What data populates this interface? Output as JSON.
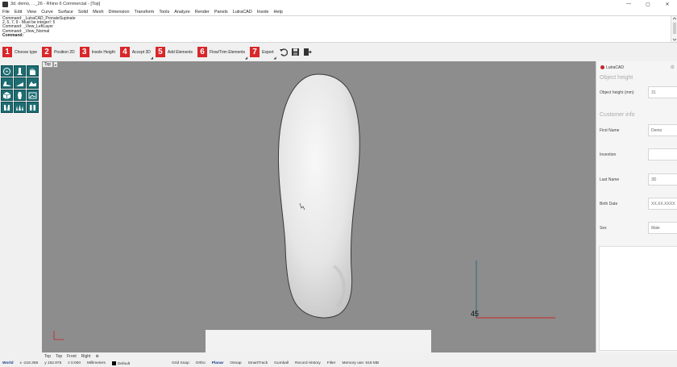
{
  "window": {
    "title": "3d. demo, . ._26 - Rhino 6 Commercial - [Top]",
    "controls": [
      "—",
      "▢",
      "✕"
    ]
  },
  "menu": [
    "File",
    "Edit",
    "View",
    "Curve",
    "Surface",
    "Solid",
    "Mesh",
    "Dimension",
    "Transform",
    "Tools",
    "Analyze",
    "Render",
    "Panels",
    "LutraCAD",
    "Insole",
    "Help"
  ],
  "command_history": [
    "Command: _LutraCAD_PronateSupinate",
    "2, 5, 7, 9 - Must be integer!: 5",
    "Command: _View_LeftLayer",
    "Command: _View_Normal"
  ],
  "command_prompt": "Command:",
  "command_value": "",
  "workflow_steps": [
    {
      "num": "1",
      "label": "Choose type"
    },
    {
      "num": "2",
      "label": "Position 2D"
    },
    {
      "num": "3",
      "label": "Insole Height"
    },
    {
      "num": "4",
      "label": "Accept 3D"
    },
    {
      "num": "5",
      "label": "Add Elements"
    },
    {
      "num": "6",
      "label": "Flow/Trim Elements"
    },
    {
      "num": "7",
      "label": "Export"
    }
  ],
  "toolbar_icons": [
    "undo-icon",
    "save-icon",
    "exit-icon"
  ],
  "viewport": {
    "label": "Top",
    "dropdown": "▾",
    "axis_label": "45",
    "colors": {
      "background": "#8d8d8d",
      "x_axis": "#c62828",
      "y_axis": "#2f6c7a"
    }
  },
  "left_tools": [
    "foot-circle-icon",
    "foot-front-icon",
    "foot-hand-icon",
    "foot-side-icon",
    "foot-ramp-icon",
    "foot-cross-icon",
    "cube-icon",
    "foot-print-icon",
    "image-icon",
    "foot-pair-icon",
    "foot-pair-front-icon",
    "foot-pair-back-icon"
  ],
  "right_panel": {
    "brand": "LutraCAD",
    "object_height_section": "Object height",
    "object_height_label": "Object height (mm)",
    "object_height_value": "31",
    "customer_info_section": "Customer info",
    "fields": [
      {
        "label": "First Name",
        "value": "Demo"
      },
      {
        "label": "Invention",
        "value": ""
      },
      {
        "label": "Last Name",
        "value": "3D"
      },
      {
        "label": "Birth Date",
        "value": "XX.XX.XXXX"
      },
      {
        "label": "Sex",
        "value": "Male"
      }
    ]
  },
  "bottom_tabs": [
    "Top",
    "Top",
    "Front",
    "Right",
    "⊕"
  ],
  "status_bar": {
    "cplane": "World",
    "x": "x -216.369",
    "y": "y 152.875",
    "z": "z 0.000",
    "units": "Millimeters",
    "layer": "Default",
    "toggles": [
      "Grid Snap",
      "Ortho",
      "Planar",
      "Osnap",
      "SmartTrack",
      "Gumball",
      "Record History",
      "Filter"
    ],
    "memory": "Memory use: 618 MB"
  }
}
